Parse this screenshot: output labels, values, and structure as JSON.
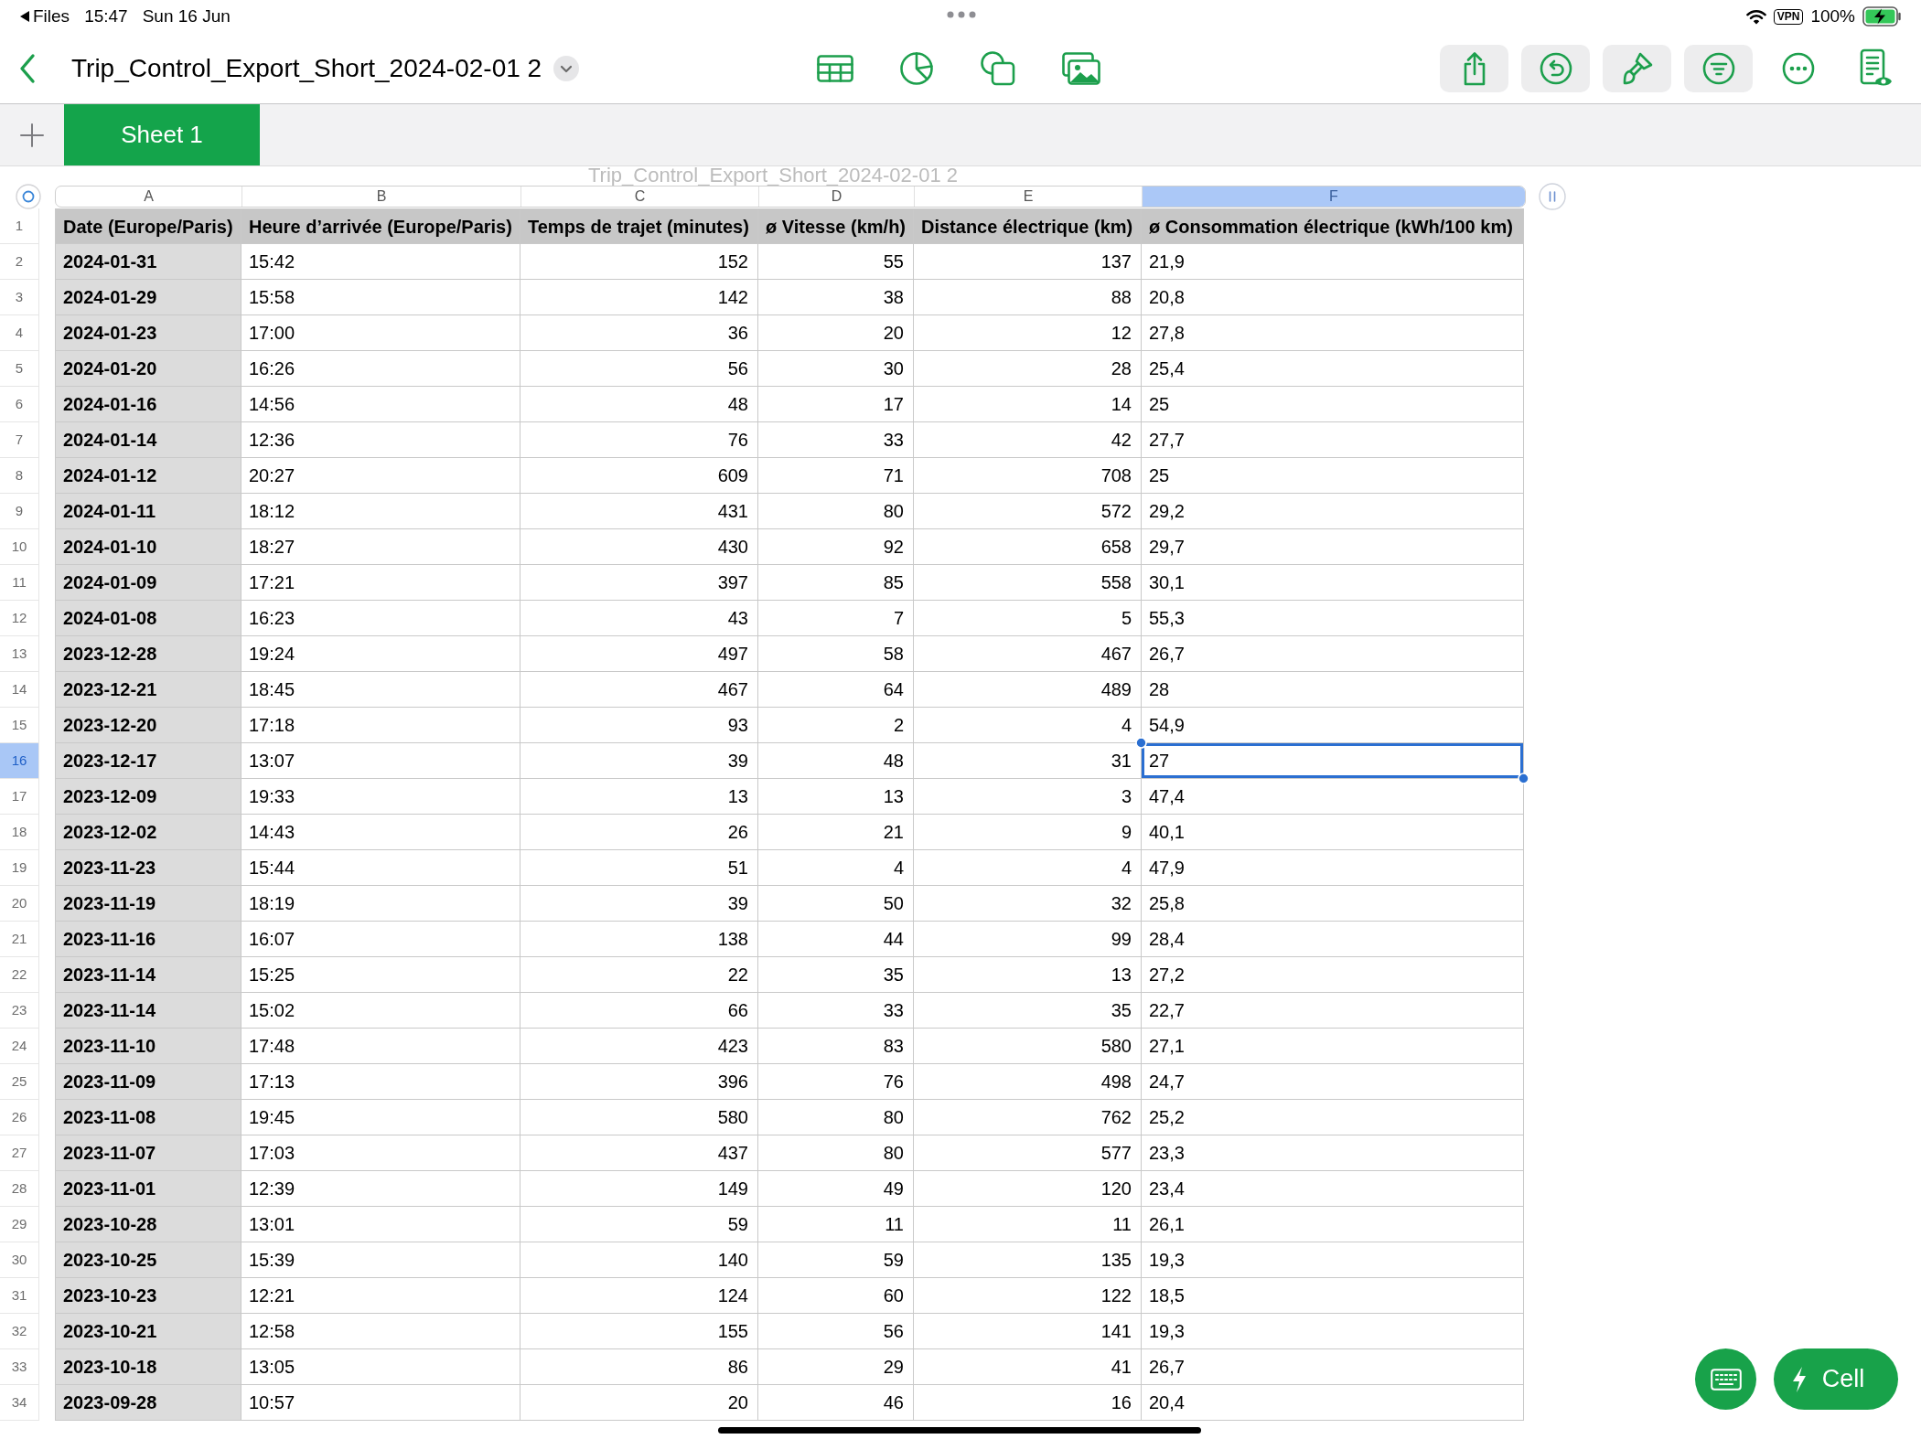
{
  "status_bar": {
    "back_label": "Files",
    "time": "15:47",
    "date": "Sun 16 Jun",
    "vpn": "VPN",
    "battery": "100%"
  },
  "toolbar": {
    "title": "Trip_Control_Export_Short_2024-02-01 2"
  },
  "sheet_tabs": [
    {
      "label": "Sheet 1",
      "selected": true
    }
  ],
  "table": {
    "title": "Trip_Control_Export_Short_2024-02-01 2",
    "columns": [
      {
        "letter": "A",
        "kind": "header",
        "selected": false
      },
      {
        "letter": "B",
        "kind": "text",
        "selected": false
      },
      {
        "letter": "C",
        "kind": "number",
        "selected": false
      },
      {
        "letter": "D",
        "kind": "number",
        "selected": false
      },
      {
        "letter": "E",
        "kind": "number",
        "selected": false
      },
      {
        "letter": "F",
        "kind": "text",
        "selected": true
      }
    ],
    "header_row": {
      "number": "1",
      "selected": false,
      "cells": [
        "Date (Europe/Paris)",
        "Heure d’arrivée (Europe/Paris)",
        "Temps de trajet (minutes)",
        "ø Vitesse (km/h)",
        "Distance électrique (km)",
        "ø Consommation électrique (kWh/100 km)"
      ]
    },
    "rows": [
      {
        "number": "2",
        "selected": false,
        "cells": [
          "2024-01-31",
          "15:42",
          "152",
          "55",
          "137",
          "21,9"
        ]
      },
      {
        "number": "3",
        "selected": false,
        "cells": [
          "2024-01-29",
          "15:58",
          "142",
          "38",
          "88",
          "20,8"
        ]
      },
      {
        "number": "4",
        "selected": false,
        "cells": [
          "2024-01-23",
          "17:00",
          "36",
          "20",
          "12",
          "27,8"
        ]
      },
      {
        "number": "5",
        "selected": false,
        "cells": [
          "2024-01-20",
          "16:26",
          "56",
          "30",
          "28",
          "25,4"
        ]
      },
      {
        "number": "6",
        "selected": false,
        "cells": [
          "2024-01-16",
          "14:56",
          "48",
          "17",
          "14",
          "25"
        ]
      },
      {
        "number": "7",
        "selected": false,
        "cells": [
          "2024-01-14",
          "12:36",
          "76",
          "33",
          "42",
          "27,7"
        ]
      },
      {
        "number": "8",
        "selected": false,
        "cells": [
          "2024-01-12",
          "20:27",
          "609",
          "71",
          "708",
          "25"
        ]
      },
      {
        "number": "9",
        "selected": false,
        "cells": [
          "2024-01-11",
          "18:12",
          "431",
          "80",
          "572",
          "29,2"
        ]
      },
      {
        "number": "10",
        "selected": false,
        "cells": [
          "2024-01-10",
          "18:27",
          "430",
          "92",
          "658",
          "29,7"
        ]
      },
      {
        "number": "11",
        "selected": false,
        "cells": [
          "2024-01-09",
          "17:21",
          "397",
          "85",
          "558",
          "30,1"
        ]
      },
      {
        "number": "12",
        "selected": false,
        "cells": [
          "2024-01-08",
          "16:23",
          "43",
          "7",
          "5",
          "55,3"
        ]
      },
      {
        "number": "13",
        "selected": false,
        "cells": [
          "2023-12-28",
          "19:24",
          "497",
          "58",
          "467",
          "26,7"
        ]
      },
      {
        "number": "14",
        "selected": false,
        "cells": [
          "2023-12-21",
          "18:45",
          "467",
          "64",
          "489",
          "28"
        ]
      },
      {
        "number": "15",
        "selected": false,
        "cells": [
          "2023-12-20",
          "17:18",
          "93",
          "2",
          "4",
          "54,9"
        ]
      },
      {
        "number": "16",
        "selected": true,
        "cells": [
          "2023-12-17",
          "13:07",
          "39",
          "48",
          "31",
          "27"
        ]
      },
      {
        "number": "17",
        "selected": false,
        "cells": [
          "2023-12-09",
          "19:33",
          "13",
          "13",
          "3",
          "47,4"
        ]
      },
      {
        "number": "18",
        "selected": false,
        "cells": [
          "2023-12-02",
          "14:43",
          "26",
          "21",
          "9",
          "40,1"
        ]
      },
      {
        "number": "19",
        "selected": false,
        "cells": [
          "2023-11-23",
          "15:44",
          "51",
          "4",
          "4",
          "47,9"
        ]
      },
      {
        "number": "20",
        "selected": false,
        "cells": [
          "2023-11-19",
          "18:19",
          "39",
          "50",
          "32",
          "25,8"
        ]
      },
      {
        "number": "21",
        "selected": false,
        "cells": [
          "2023-11-16",
          "16:07",
          "138",
          "44",
          "99",
          "28,4"
        ]
      },
      {
        "number": "22",
        "selected": false,
        "cells": [
          "2023-11-14",
          "15:25",
          "22",
          "35",
          "13",
          "27,2"
        ]
      },
      {
        "number": "23",
        "selected": false,
        "cells": [
          "2023-11-14",
          "15:02",
          "66",
          "33",
          "35",
          "22,7"
        ]
      },
      {
        "number": "24",
        "selected": false,
        "cells": [
          "2023-11-10",
          "17:48",
          "423",
          "83",
          "580",
          "27,1"
        ]
      },
      {
        "number": "25",
        "selected": false,
        "cells": [
          "2023-11-09",
          "17:13",
          "396",
          "76",
          "498",
          "24,7"
        ]
      },
      {
        "number": "26",
        "selected": false,
        "cells": [
          "2023-11-08",
          "19:45",
          "580",
          "80",
          "762",
          "25,2"
        ]
      },
      {
        "number": "27",
        "selected": false,
        "cells": [
          "2023-11-07",
          "17:03",
          "437",
          "80",
          "577",
          "23,3"
        ]
      },
      {
        "number": "28",
        "selected": false,
        "cells": [
          "2023-11-01",
          "12:39",
          "149",
          "49",
          "120",
          "23,4"
        ]
      },
      {
        "number": "29",
        "selected": false,
        "cells": [
          "2023-10-28",
          "13:01",
          "59",
          "11",
          "11",
          "26,1"
        ]
      },
      {
        "number": "30",
        "selected": false,
        "cells": [
          "2023-10-25",
          "15:39",
          "140",
          "59",
          "135",
          "19,3"
        ]
      },
      {
        "number": "31",
        "selected": false,
        "cells": [
          "2023-10-23",
          "12:21",
          "124",
          "60",
          "122",
          "18,5"
        ]
      },
      {
        "number": "32",
        "selected": false,
        "cells": [
          "2023-10-21",
          "12:58",
          "155",
          "56",
          "141",
          "19,3"
        ]
      },
      {
        "number": "33",
        "selected": false,
        "cells": [
          "2023-10-18",
          "13:05",
          "86",
          "29",
          "41",
          "26,7"
        ]
      },
      {
        "number": "34",
        "selected": false,
        "cells": [
          "2023-09-28",
          "10:57",
          "20",
          "46",
          "16",
          "20,4"
        ]
      }
    ]
  },
  "quick_actions": {
    "cell_button": "Cell"
  }
}
